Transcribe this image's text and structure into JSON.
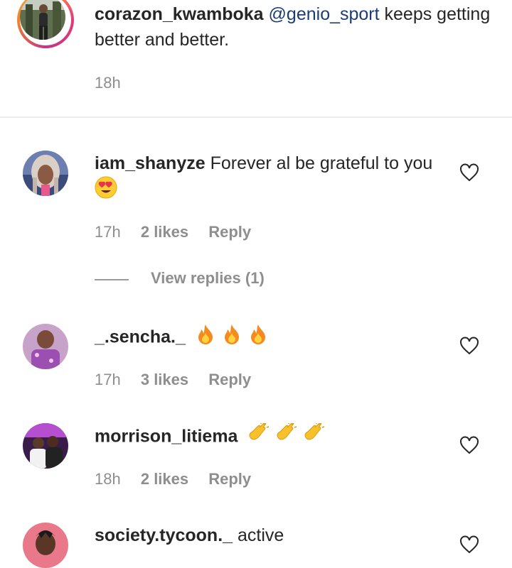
{
  "caption": {
    "username": "corazon_kwamboka",
    "mention": "@genio_sport",
    "text": " keeps getting better and better.",
    "time": "18h"
  },
  "comments": [
    {
      "username": "iam_shanyze",
      "text": " Forever al be grateful to you",
      "emoji": "heart-eyes",
      "time": "17h",
      "likes": "2 likes",
      "reply": "Reply"
    },
    {
      "username": "_.sencha._",
      "text": "",
      "emoji": "fire x3",
      "time": "17h",
      "likes": "3 likes",
      "reply": "Reply"
    },
    {
      "username": "morrison_litiema",
      "text": "",
      "emoji": "clapping-hands x3",
      "time": "18h",
      "likes": "2 likes",
      "reply": "Reply"
    },
    {
      "username": "society.tycoon._",
      "text": " active",
      "emoji": "",
      "time": "",
      "likes": "",
      "reply": ""
    }
  ],
  "view_replies": "View replies (1)",
  "colors": {
    "text": "#262626",
    "meta": "#8e8e8e",
    "mention": "#1c3d73",
    "divider": "#ececec"
  },
  "icons": [
    "heart-outline-icon",
    "fire-emoji",
    "clapping-hands-emoji",
    "heart-eyes-emoji"
  ]
}
